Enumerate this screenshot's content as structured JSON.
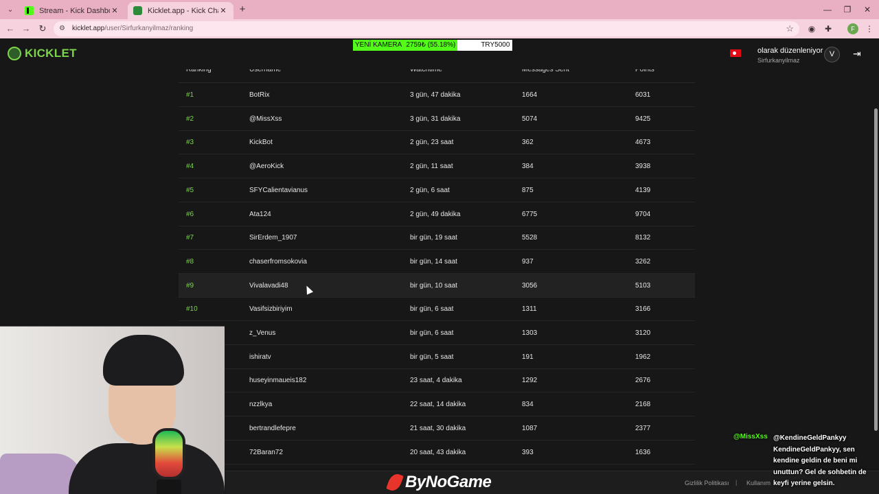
{
  "browser": {
    "tabs": [
      {
        "title": "Stream - Kick Dashboard",
        "icon": "kick-favicon-icon",
        "active": false
      },
      {
        "title": "Kicklet.app - Kick Chatbot and",
        "icon": "kicklet-favicon-icon",
        "active": true
      }
    ],
    "url_domain": "kicklet.app",
    "url_path": "/user/Sirfurkanyilmaz/ranking"
  },
  "header": {
    "logo": "KICKLET",
    "promo": {
      "camera": "YENİ KAMERA",
      "price": "2759₺ (55.18%)",
      "code": "TRY5000"
    },
    "user_line": "olarak düzenleniyor",
    "username": "Sirfurkanyilmaz"
  },
  "table": {
    "headers": [
      "Ranking",
      "Username",
      "Watchtime",
      "Messages Sent",
      "Points"
    ],
    "rows": [
      {
        "rank": "#1",
        "user": "BotRix",
        "watch": "3 gün, 47 dakika",
        "msgs": "1664",
        "points": "6031"
      },
      {
        "rank": "#2",
        "user": "@MissXss",
        "watch": "3 gün, 31 dakika",
        "msgs": "5074",
        "points": "9425"
      },
      {
        "rank": "#3",
        "user": "KickBot",
        "watch": "2 gün, 23 saat",
        "msgs": "362",
        "points": "4673"
      },
      {
        "rank": "#4",
        "user": "@AeroKick",
        "watch": "2 gün, 11 saat",
        "msgs": "384",
        "points": "3938"
      },
      {
        "rank": "#5",
        "user": "SFYCalientavianus",
        "watch": "2 gün, 6 saat",
        "msgs": "875",
        "points": "4139"
      },
      {
        "rank": "#6",
        "user": "Ata124",
        "watch": "2 gün, 49 dakika",
        "msgs": "6775",
        "points": "9704"
      },
      {
        "rank": "#7",
        "user": "SirErdem_1907",
        "watch": "bir gün, 19 saat",
        "msgs": "5528",
        "points": "8132"
      },
      {
        "rank": "#8",
        "user": "chaserfromsokovia",
        "watch": "bir gün, 14 saat",
        "msgs": "937",
        "points": "3262"
      },
      {
        "rank": "#9",
        "user": "Vivalavadi48",
        "watch": "bir gün, 10 saat",
        "msgs": "3056",
        "points": "5103"
      },
      {
        "rank": "#10",
        "user": "Vasifsizbiriyim",
        "watch": "bir gün, 6 saat",
        "msgs": "1311",
        "points": "3166"
      },
      {
        "rank": "",
        "user": "z_Venus",
        "watch": "bir gün, 6 saat",
        "msgs": "1303",
        "points": "3120"
      },
      {
        "rank": "",
        "user": "ishiratv",
        "watch": "bir gün, 5 saat",
        "msgs": "191",
        "points": "1962"
      },
      {
        "rank": "",
        "user": "huseyinmaueis182",
        "watch": "23 saat, 4 dakika",
        "msgs": "1292",
        "points": "2676"
      },
      {
        "rank": "",
        "user": "nzzlkya",
        "watch": "22 saat, 14 dakika",
        "msgs": "834",
        "points": "2168"
      },
      {
        "rank": "",
        "user": "bertrandlefepre",
        "watch": "21 saat, 30 dakika",
        "msgs": "1087",
        "points": "2377"
      },
      {
        "rank": "",
        "user": "72Baran72",
        "watch": "20 saat, 43 dakika",
        "msgs": "393",
        "points": "1636"
      }
    ]
  },
  "footer": {
    "privacy": "Gizlilik Politikası",
    "separator": "|",
    "terms": "Kullanım"
  },
  "overlay": {
    "chat_user": "@MissXss",
    "chat_text": "@KendineGeldPankyy KendineGeldPankyy, sen kendine geldin de beni mi unuttun? Gel de sohbetin de keyfi yerine gelsin.",
    "sponsor": "ByNoGame"
  }
}
